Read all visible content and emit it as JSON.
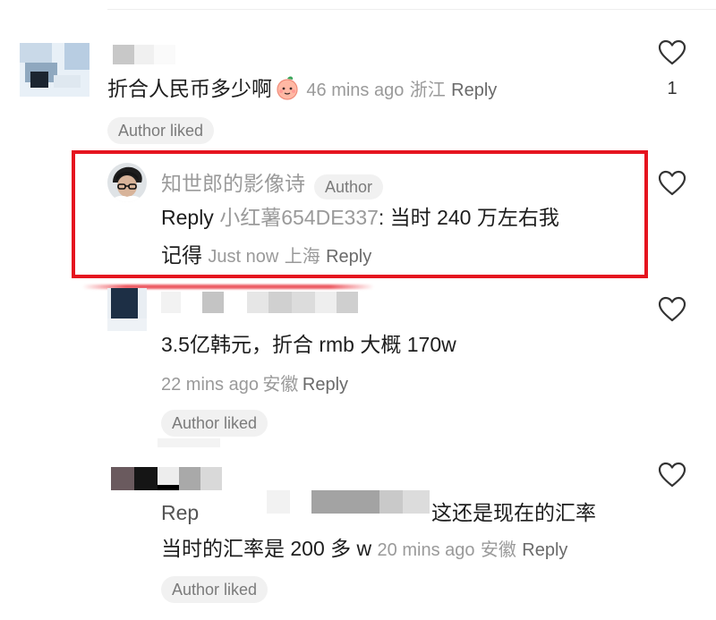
{
  "comments": [
    {
      "text": "折合人民币多少啊",
      "emoji_icon": "peach-face-emoji-icon",
      "time": "46 mins ago",
      "location": "浙江",
      "reply_label": "Reply",
      "badge": "Author liked",
      "likes": "1"
    },
    {
      "author_name": "知世郎的影像诗",
      "author_tag": "Author",
      "reply_prefix": "Reply",
      "mention": "小红薯654DE337",
      "text_line1": ": 当时 240 万左右我",
      "text_line2": "记得",
      "time": "Just now",
      "location": "上海",
      "reply_label": "Reply"
    },
    {
      "text": "3.5亿韩元，折合 rmb 大概 170w",
      "time": "22 mins ago",
      "location": "安徽",
      "reply_label": "Reply",
      "badge": "Author liked"
    },
    {
      "reply_prefix": "Rep",
      "text_line1": "这还是现在的汇率",
      "text_line2": "当时的汇率是 200 多 w",
      "time": "20 mins ago",
      "location": "安徽",
      "reply_label": "Reply",
      "badge": "Author liked"
    }
  ],
  "colors": {
    "highlight": "#e5141f",
    "muted_text": "#9a9a9a",
    "badge_bg": "#f1f1f1"
  },
  "icons": {
    "like": "heart-outline-icon"
  }
}
